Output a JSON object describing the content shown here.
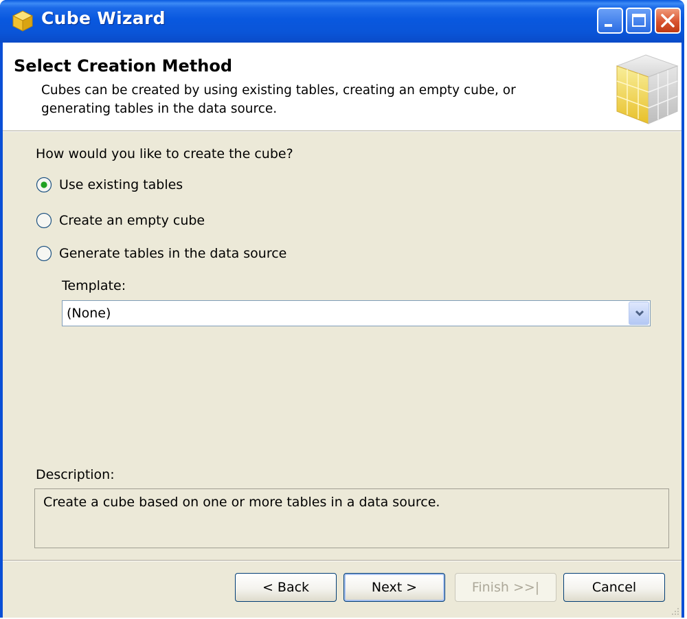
{
  "window": {
    "title": "Cube Wizard"
  },
  "header": {
    "title": "Select Creation Method",
    "subtitle": "Cubes can be created by using existing tables, creating an empty cube, or generating tables in the data source."
  },
  "form": {
    "question": "How would you like to create the cube?",
    "options": [
      {
        "label": "Use existing tables",
        "selected": true
      },
      {
        "label": "Create an empty cube",
        "selected": false
      },
      {
        "label": "Generate tables in the data source",
        "selected": false
      }
    ],
    "template_label": "Template:",
    "template_value": "(None)"
  },
  "description": {
    "label": "Description:",
    "text": "Create a cube based on one or more tables in a data source."
  },
  "buttons": {
    "back": "< Back",
    "next": "Next >",
    "finish": "Finish >>|",
    "cancel": "Cancel"
  },
  "icons": {
    "app": "cube-icon",
    "header_art": "cube-graphic-icon"
  },
  "colors": {
    "titlebar": "#0a58de",
    "dialog_bg": "#ece9d8",
    "radio_selected": "#21a121"
  }
}
